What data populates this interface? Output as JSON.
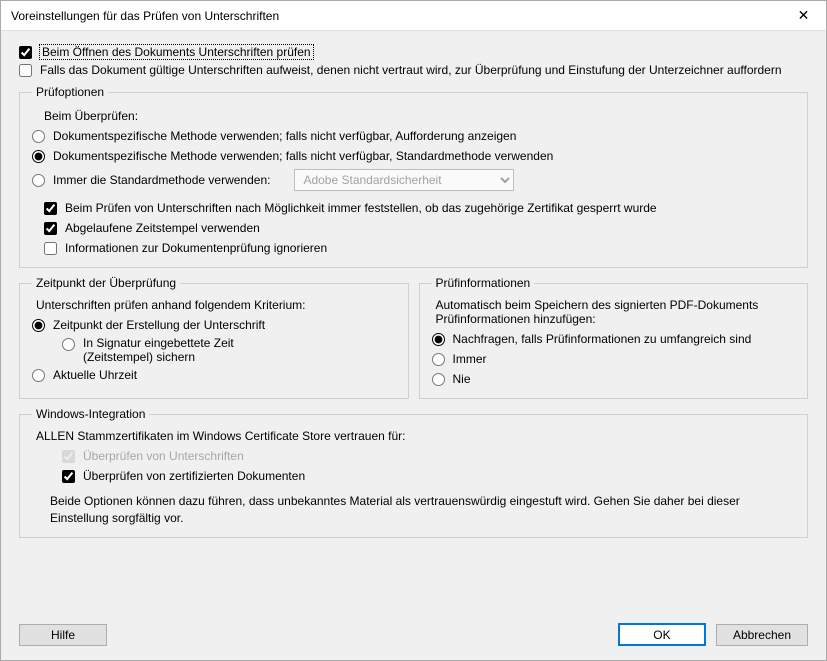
{
  "title": "Voreinstellungen für das Prüfen von Unterschriften",
  "top": {
    "check_verify_open": "Beim Öffnen des Dokuments Unterschriften prüfen",
    "check_untrusted": "Falls das Dokument gültige Unterschriften aufweist, denen nicht vertraut wird, zur Überprüfung und Einstufung der Unterzeichner auffordern"
  },
  "groups": {
    "pruefoptionen": {
      "legend": "Prüfoptionen",
      "sublabel": "Beim Überprüfen:",
      "opt1": "Dokumentspezifische Methode verwenden; falls nicht verfügbar, Aufforderung anzeigen",
      "opt2": "Dokumentspezifische Methode verwenden; falls nicht verfügbar, Standardmethode verwenden",
      "opt3": "Immer die Standardmethode verwenden:",
      "select_value": "Adobe Standardsicherheit",
      "chk_revoke": "Beim Prüfen von Unterschriften nach Möglichkeit immer feststellen, ob das zugehörige Zertifikat gesperrt wurde",
      "chk_expired": "Abgelaufene Zeitstempel verwenden",
      "chk_ignore": "Informationen zur Dokumentenprüfung ignorieren"
    },
    "zeitpunkt": {
      "legend": "Zeitpunkt der Überprüfung",
      "sublabel": "Unterschriften prüfen anhand folgendem Kriterium:",
      "opt1": "Zeitpunkt der Erstellung der Unterschrift",
      "opt2a": "In Signatur eingebettete Zeit",
      "opt2b": "(Zeitstempel) sichern",
      "opt3": "Aktuelle Uhrzeit"
    },
    "pruefinfo": {
      "legend": "Prüfinformationen",
      "sublabel1": "Automatisch beim Speichern des signierten PDF-Dokuments",
      "sublabel2": "Prüfinformationen hinzufügen:",
      "opt1": "Nachfragen, falls Prüfinformationen zu umfangreich sind",
      "opt2": "Immer",
      "opt3": "Nie"
    },
    "windows": {
      "legend": "Windows-Integration",
      "sublabel": "ALLEN Stammzertifikaten im Windows Certificate Store vertrauen für:",
      "chk1": "Überprüfen von Unterschriften",
      "chk2": "Überprüfen von zertifizierten Dokumenten",
      "note": "Beide Optionen können dazu führen, dass unbekanntes Material als vertrauenswürdig eingestuft wird. Gehen Sie daher bei dieser Einstellung sorgfältig vor."
    }
  },
  "buttons": {
    "help": "Hilfe",
    "ok": "OK",
    "cancel": "Abbrechen"
  }
}
